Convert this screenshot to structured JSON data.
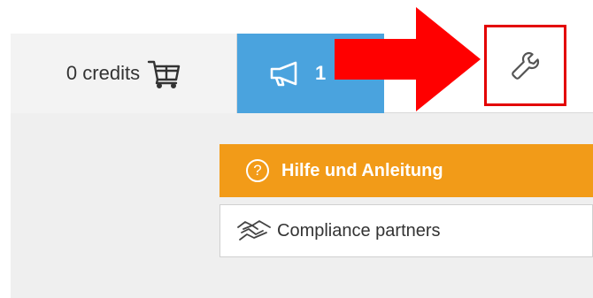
{
  "toolbar": {
    "credits_label": "0 credits",
    "credits_icon": "cart-icon",
    "news_count": "1",
    "news_icon": "megaphone-icon",
    "settings_icon": "wrench-icon"
  },
  "menu": {
    "help_label": "Hilfe und Anleitung",
    "help_icon": "question-circle-icon",
    "partners_label": "Compliance partners",
    "partners_icon": "handshake-icon"
  },
  "annotation": {
    "arrow_color": "#ff0000",
    "highlight_color": "#e30000"
  },
  "colors": {
    "news_bg": "#4aa3de",
    "help_bg": "#f29b18"
  }
}
